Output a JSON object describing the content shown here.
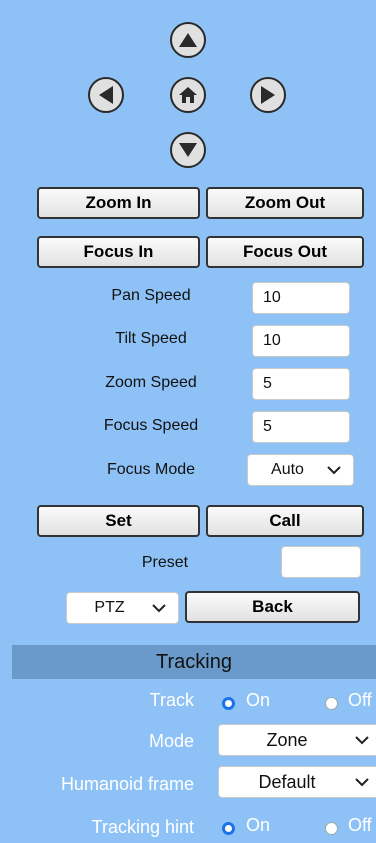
{
  "ptz": {
    "direction_icons": {
      "up": "arrow-up-icon",
      "left": "arrow-left-icon",
      "home": "home-icon",
      "right": "arrow-right-icon",
      "down": "arrow-down-icon"
    },
    "zoom_in_label": "Zoom In",
    "zoom_out_label": "Zoom Out",
    "focus_in_label": "Focus In",
    "focus_out_label": "Focus Out",
    "pan_speed": {
      "label": "Pan Speed",
      "value": "10"
    },
    "tilt_speed": {
      "label": "Tilt Speed",
      "value": "10"
    },
    "zoom_speed": {
      "label": "Zoom Speed",
      "value": "5"
    },
    "focus_speed": {
      "label": "Focus Speed",
      "value": "5"
    },
    "focus_mode": {
      "label": "Focus Mode",
      "value": "Auto"
    },
    "set_label": "Set",
    "call_label": "Call",
    "preset": {
      "label": "Preset",
      "value": ""
    },
    "mode_select": {
      "value": "PTZ"
    },
    "back_label": "Back"
  },
  "tracking": {
    "header": "Tracking",
    "track": {
      "label": "Track",
      "on_label": "On",
      "off_label": "Off",
      "selected": "On"
    },
    "mode": {
      "label": "Mode",
      "value": "Zone"
    },
    "humanoid_frame": {
      "label": "Humanoid frame",
      "value": "Default"
    },
    "tracking_hint": {
      "label": "Tracking hint",
      "on_label": "On",
      "off_label": "Off",
      "selected": "On"
    }
  },
  "colors": {
    "background": "#8ec2f6",
    "section_header": "#6a9ac9",
    "radio_accent": "#1a73e8"
  }
}
